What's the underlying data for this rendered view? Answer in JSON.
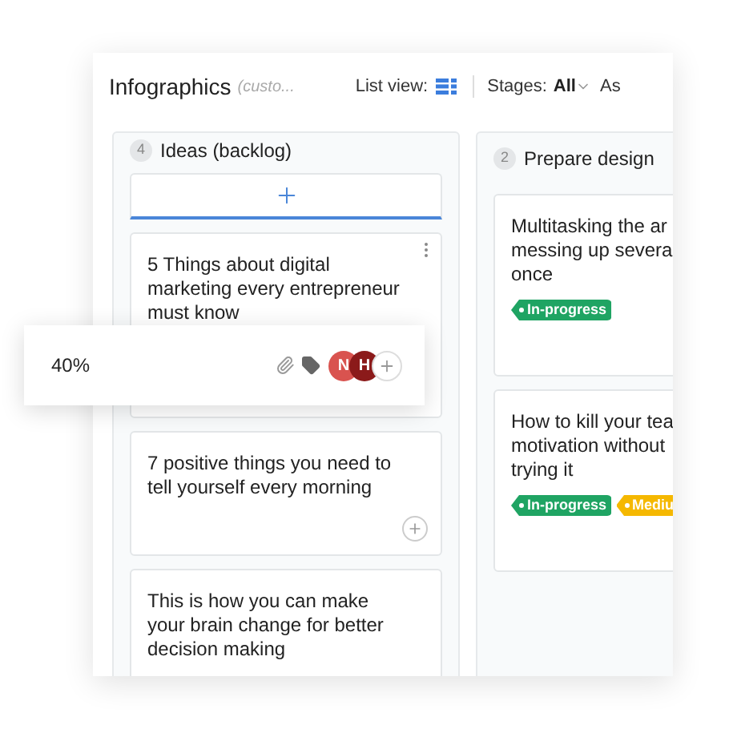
{
  "board": {
    "title": "Infographics",
    "subtitle": "(custo...",
    "list_view_label": "List view:",
    "stages_label": "Stages:",
    "stages_value": "All",
    "cut_label": "As"
  },
  "columns": [
    {
      "count": "4",
      "name": "Ideas (backlog)",
      "add_button": true,
      "cards": [
        {
          "lines": [
            "5 Things about digital",
            "marketing every entrepreneur",
            "must know"
          ],
          "menu": true
        },
        {
          "lines": [
            "7 positive things you need to",
            "tell yourself every morning"
          ],
          "add": true
        },
        {
          "lines": [
            "This is how you can make",
            "your brain change for better",
            "decision making"
          ]
        }
      ]
    },
    {
      "count": "2",
      "name": "Prepare design",
      "cards": [
        {
          "lines": [
            "Multitasking the ar",
            "messing up severa",
            "once"
          ],
          "tags": [
            {
              "label": "In-progress",
              "color": "#1fa463"
            }
          ]
        },
        {
          "lines": [
            "How to kill your tea",
            "motivation without",
            "trying it"
          ],
          "tags": [
            {
              "label": "In-progress",
              "color": "#1fa463"
            },
            {
              "label": "Mediu",
              "color": "#f5b800"
            }
          ]
        }
      ]
    }
  ],
  "floating_card": {
    "progress": "40%",
    "avatars": [
      {
        "initial": "N",
        "color": "#d9534f"
      },
      {
        "initial": "H",
        "color": "#8b1a1a"
      }
    ]
  }
}
